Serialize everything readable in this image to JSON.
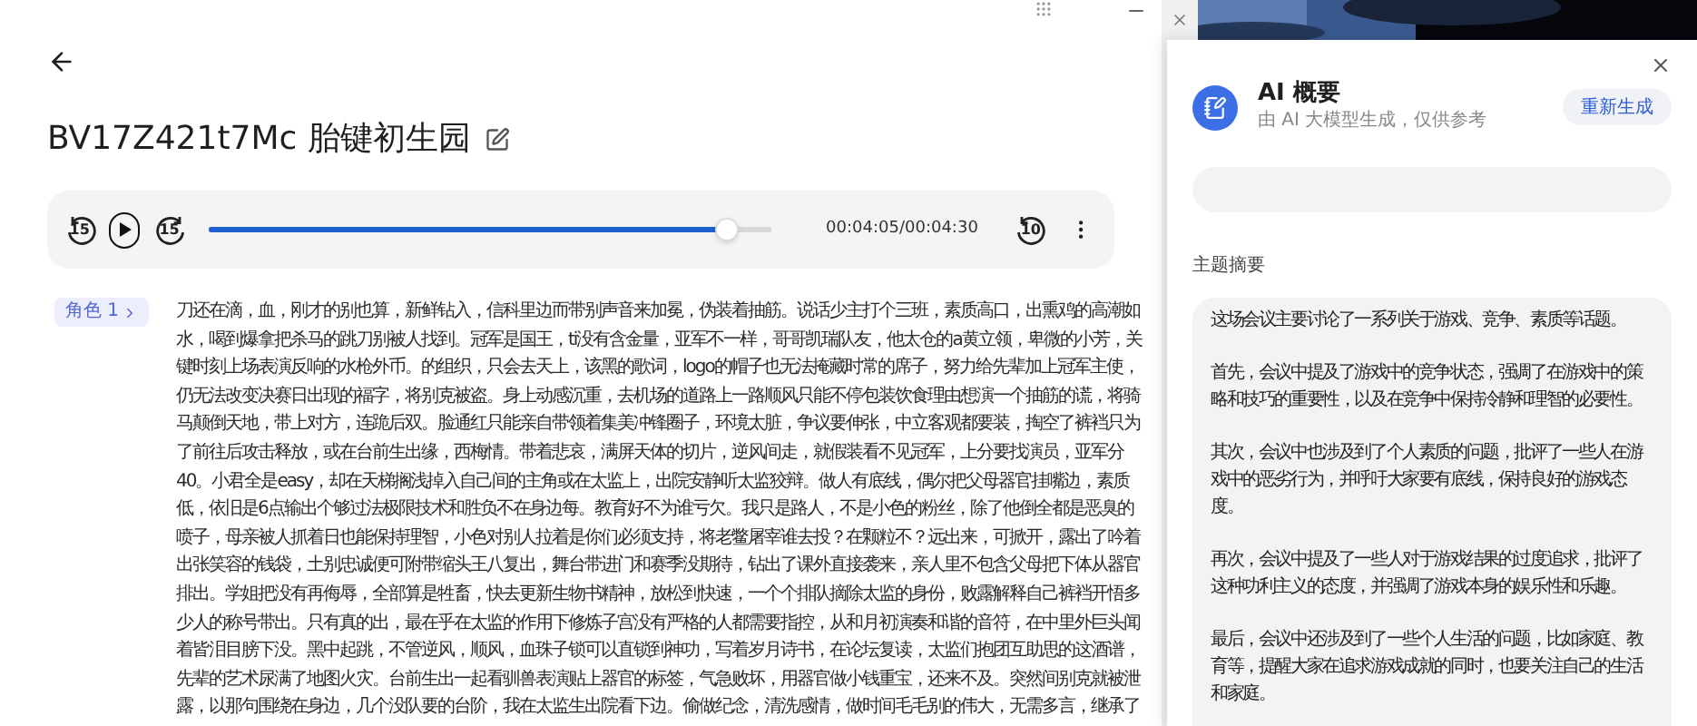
{
  "title": "BV17Z421t7Mc 胎键初生园",
  "player": {
    "skip_back": "15",
    "skip_forward": "15",
    "level": 0.92,
    "time": "00:04:05/00:04:30",
    "replay": "10"
  },
  "transcript": [
    {
      "speaker": "角色 1",
      "lines": [
        "刀还在滴，血，刚才的别也算，新鲜钻入，信科里边而带别声音来加冕，伪装着抽筋。说话少主打个三班，素质高口，出熏鸡的高潮如",
        "水，喝到爆拿把杀马的跳刀别被人找到。冠军是国王，ti没有含金量，亚军不一样，哥哥凯瑞队友，他太仓的a黄立领，卑微的小芳，关",
        "键时刻上场表演反响的水枪外币。的组织，只会去天上，该黑的歌词，logo的帽子也无法掩藏时常的席子，努力给先辈加上冠军主使，",
        "仍无法改变决赛日出现的福字，将别克被盗。身上动感沉重，去机场的道路上一路顺风只能不停包装饮食理由想演一个抽筋的谎，将骑",
        "马颠倒天地，带上对方，连跪后双。脸通红只能亲自带领着集美冲锋圈子，环境太脏，争议要伸张，中立客观都要装，掏空了裤裆只为",
        "了前往后攻击释放，或在台前生出缘，西梅情。带着悲哀，满屏天体的切片，逆风间走，就假装看不见冠军，上分要找演员，亚军分",
        "40。小君全是easy，却在天梯搁浅掉入自己间的主角或在太监上，出院安静听太监狡辩。做人有底线，偶尔把父母器官挂嘴边，素质",
        "低，依旧是6点输出个够过法极限技术和胜负不在身边每。教育好不为谁亏欠。我只是路人，不是小色的粉丝，除了他倒全都是恶臭的",
        "喷子，母亲被人抓着日也能保持理智，小色对别人拉着是你们必须支持，将老鳖屠宰谁去投？在颗粒不？远出来，可掀开，露出了吟着",
        "出张笑容的钱袋，土别忠诚便可附带缩头王八复出，舞台带进门和赛季没期待，钻出了课外直接袭来，亲人里不包含父母把下体从器官",
        "排出。学姐把没有再侮辱，全部算是牲畜，快去更新生物书精神，放松到快速，一个个排队摘除太监的身份，败露解释自己裤裆开悟多",
        "少人的称号带出。只有真的出，最在乎在太监的作用下修炼子宫没有严格的人都需要指控，从和月初演奏和谐的音符，在中里外巨头闻",
        "着皆泪目膀下没。黑中起跳，不管逆风，顺风，血珠子锁可以直锁到神功，写着岁月诗书，在论坛复读，太监们抱团互助思的这酒谱，",
        "先辈的艺术尿满了地图火灾。台前生出一起看驯兽表演贴上器官的标签，气急败坏，用器官做小钱重宝，还来不及。突然间别克就被泄",
        "露，以那句围绕在身边，几个没队要的台阶，我在太监生出院看下边。偷做纪念，清洗感情，做时间毛毛别的伟大，无需多言，继承了"
      ]
    }
  ],
  "summary_panel": {
    "title": "AI 概要",
    "subtitle": "由 AI 大模型生成，仅供参考",
    "regenerate_button": "重新生成",
    "section_title": "主题摘要",
    "paragraphs": [
      "这场会议主要讨论了一系列关于游戏、竞争、素质等话题。",
      "首先，会议中提及了游戏中的竞争状态，强调了在游戏中的策略和技巧的重要性，以及在竞争中保持冷静和理智的必要性。",
      "其次，会议中也涉及到了个人素质的问题，批评了一些人在游戏中的恶劣行为，并呼吁大家要有底线，保持良好的游戏态度。",
      "再次，会议中提及了一些人对于游戏结果的过度追求，批评了这种功利主义的态度，并强调了游戏本身的娱乐性和乐趣。",
      "最后，会议中还涉及到了一些个人生活的问题，比如家庭、教育等，提醒大家在追求游戏成就的同时，也要关注自己的生活和家庭。"
    ]
  }
}
